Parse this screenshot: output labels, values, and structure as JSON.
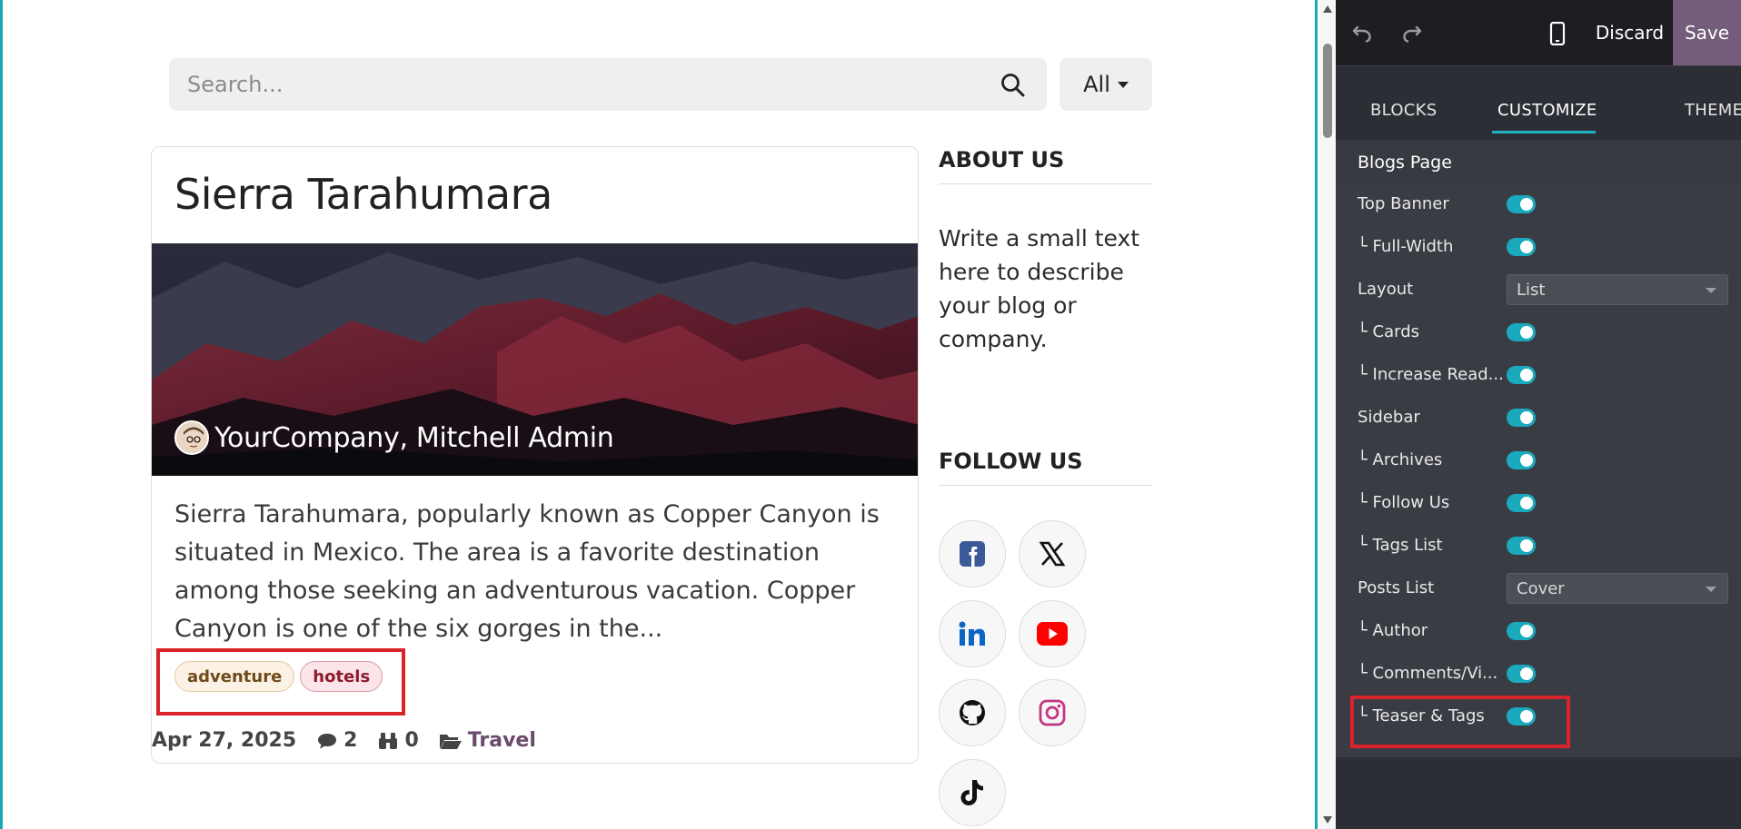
{
  "search": {
    "placeholder": "Search...",
    "filter_label": "All"
  },
  "post": {
    "title": "Sierra Tarahumara",
    "author": "YourCompany, Mitchell Admin",
    "teaser": "Sierra Tarahumara, popularly known as Copper Canyon is situated in Mexico. The area is a favorite destination among those seeking an adventurous vacation. Copper Canyon is one of the six gorges in the...",
    "tags": [
      "adventure",
      "hotels"
    ],
    "date": "Apr 27, 2025",
    "comments": "2",
    "views": "0",
    "category": "Travel"
  },
  "sidebar": {
    "about_heading": "ABOUT US",
    "about_text": "Write a small text here to describe your blog or company.",
    "follow_heading": "FOLLOW US",
    "social_icons": [
      "facebook-icon",
      "x-icon",
      "linkedin-icon",
      "youtube-icon",
      "github-icon",
      "instagram-icon",
      "tiktok-icon"
    ]
  },
  "editor": {
    "discard_label": "Discard",
    "save_label": "Save",
    "tabs": [
      "BLOCKS",
      "CUSTOMIZE",
      "THEME"
    ],
    "active_tab": "CUSTOMIZE",
    "section_title": "Blogs Page",
    "options": [
      {
        "label": "Top Banner",
        "type": "toggle",
        "on": true
      },
      {
        "label": "└ Full-Width",
        "type": "toggle",
        "on": true
      },
      {
        "label": "Layout",
        "type": "select",
        "value": "List"
      },
      {
        "label": "└ Cards",
        "type": "toggle",
        "on": true
      },
      {
        "label": "└ Increase Read...",
        "type": "toggle",
        "on": true
      },
      {
        "label": "Sidebar",
        "type": "toggle",
        "on": true
      },
      {
        "label": "└ Archives",
        "type": "toggle",
        "on": true
      },
      {
        "label": "└ Follow Us",
        "type": "toggle",
        "on": true
      },
      {
        "label": "└ Tags List",
        "type": "toggle",
        "on": true
      },
      {
        "label": "Posts List",
        "type": "select",
        "value": "Cover"
      },
      {
        "label": "└ Author",
        "type": "toggle",
        "on": true
      },
      {
        "label": "└ Comments/Vi...",
        "type": "toggle",
        "on": true
      },
      {
        "label": "└ Teaser & Tags",
        "type": "toggle",
        "on": true
      }
    ]
  },
  "colors": {
    "accent": "#1aa9bd",
    "save_button": "#735d7a",
    "highlight": "#d8232a"
  }
}
